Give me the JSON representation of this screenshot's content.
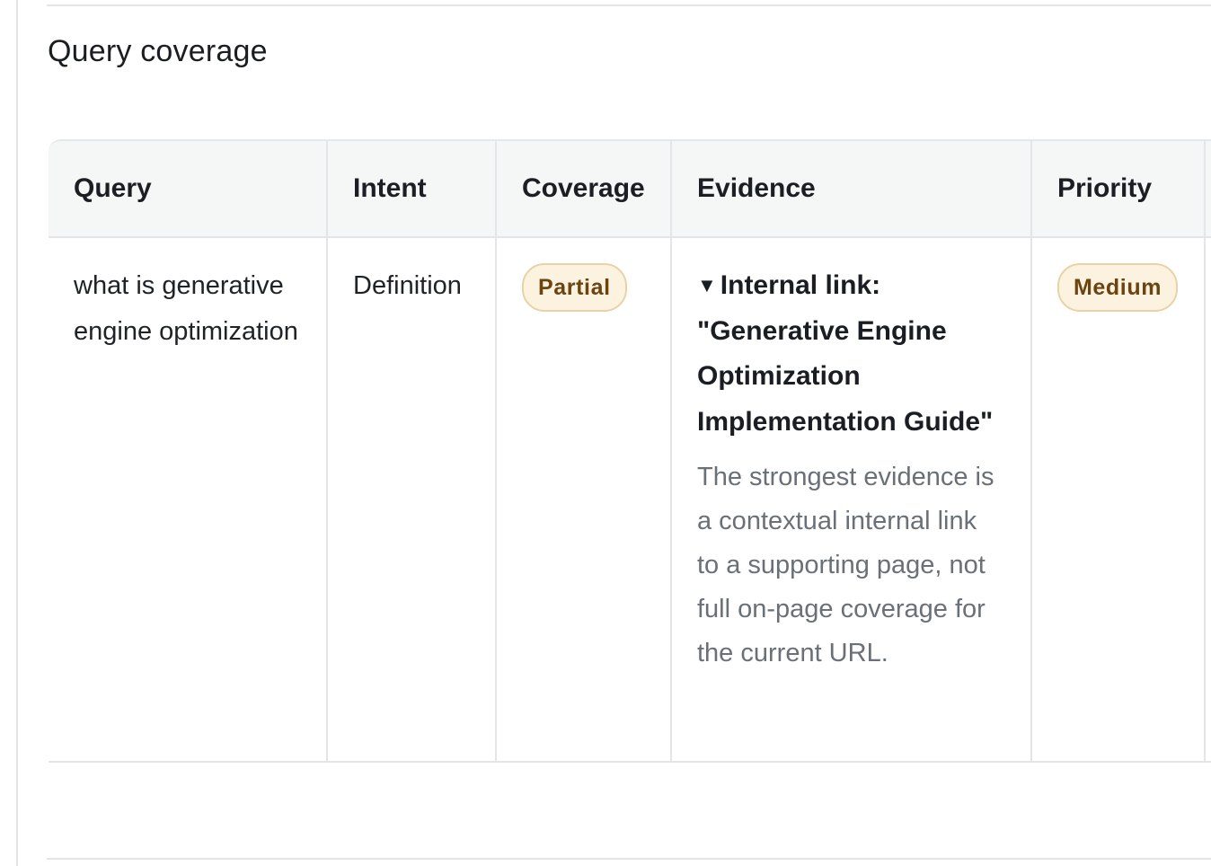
{
  "section": {
    "title": "Query coverage"
  },
  "table": {
    "headers": [
      "Query",
      "Intent",
      "Coverage",
      "Evidence",
      "Priority"
    ],
    "rows": [
      {
        "query": "what is generative engine optimization",
        "intent": "Definition",
        "coverage": "Partial",
        "evidence_title": "Internal link: \"Generative Engine Optimization Implementation Guide\"",
        "evidence_note": "The strongest evidence is a contextual internal link to a supporting page, not full on-page coverage for the current URL.",
        "priority": "Medium"
      }
    ]
  },
  "colors": {
    "badge_bg": "#fbf3df",
    "badge_text": "#6b4412",
    "badge_border": "#e9d2a5",
    "header_bg": "#f5f7f6",
    "muted_text": "#6a7077"
  },
  "icons": {
    "disclosure": "triangle-down-icon"
  }
}
